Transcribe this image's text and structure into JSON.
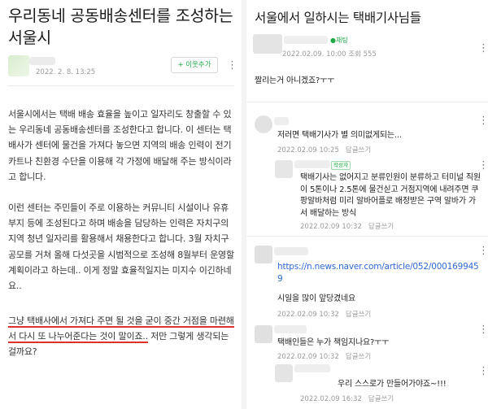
{
  "left": {
    "title": "우리동네 공동배송센터를 조성하는 서울시",
    "date": "2022. 2. 8. 13:25",
    "follow_label": "+ 이웃추가",
    "menu_icon": "kebab-icon",
    "paragraph1": "서울시에서는 택배 배송 효율을 높이고 일자리도 창출할 수 있는 우리동네 공동배송센터를 조성한다고 합니다. 이 센터는 택배사가 센터에 물건을 가져다 놓으면 지역의 배송 인력이 전기 카트나 친환경 수단을 이용해 각 가정에 배달해 주는 방식이라고 합니다.",
    "paragraph2": "이런 센터는 주민들이 주로 이용하는 커뮤니티 시설이나 유휴부지 등에 조성된다고 하며 배송을 담당하는 인력은 자치구의 지역 청년 일자리를 활용해서 채용한다고 합니다. 3월 자치구 공모를 거쳐 올해 다섯곳을 시범적으로 조성해 8월부터 운영할 계획이라고 하는데.. 이게 정말 효율적일지는 미지수 이긴하네요..",
    "paragraph3_underlined": "그냥 택배사에서 가져다 주면 될 것을 굳이 중간 거점을 마련해서 다시 또 나누어준다는 것이 말이죠..",
    "paragraph3_rest": " 저만 그렇게 생각되는 걸까요?"
  },
  "right": {
    "title": "서울에서 일하시는 택배기사님들",
    "chat_badge": "●채팅",
    "post_meta": "2022.02.09. 10:00  조회 555",
    "post_text": "짤리는거 아니겠죠?ㅜㅜ",
    "reply_label": "답글쓰기",
    "writer_badge": "작성자",
    "comments": [
      {
        "text": "저러면 택배기사가 별 의미없게되는...",
        "date": "2022.02.09 10:25"
      },
      {
        "text": "택배기사는 없어지고 분류인원이 분류하고 터미널 직원이 5톤이나 2.5톤에 물건싣고 거점지역에 내려주면 쿠팡알바처럼 미리 알바어플로 배정받은 구역 알바가 가서 배달하는 방식",
        "date": "2022.02.09 10:32"
      },
      {
        "link": "https://n.news.naver.com/article/052/0001699459",
        "text2": "시일을 많이 앞당겼네요",
        "date": "2022.02.09 10:32"
      },
      {
        "text": "택배인들은 누가 책임지나요?ㅜㅜ",
        "date": "2022.02.09 10:32"
      },
      {
        "text": "우리 스스로가 만들어가야죠~!!!",
        "date": "2022.02.09 16:32"
      }
    ]
  },
  "colors": {
    "accent": "#20a847",
    "link": "#2e6bd6",
    "underline": "#e0302a"
  }
}
